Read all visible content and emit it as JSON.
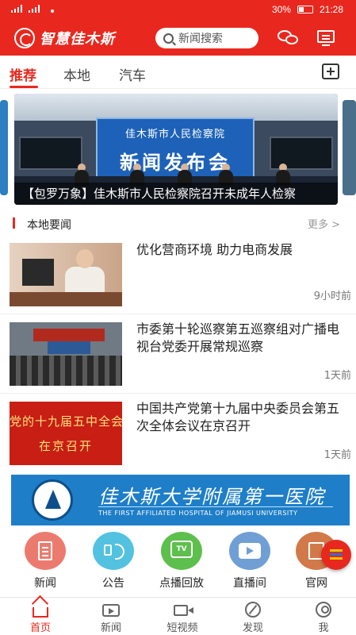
{
  "status_bar": {
    "battery": "30%",
    "time": "21:28"
  },
  "header": {
    "logo_text": "智慧佳木斯",
    "search_placeholder": "新闻搜索"
  },
  "tabs": [
    {
      "label": "推荐",
      "active": true
    },
    {
      "label": "本地",
      "active": false
    },
    {
      "label": "汽车",
      "active": false
    }
  ],
  "carousel": {
    "banner_line1": "佳木斯市人民检察院",
    "banner_line2": "新闻发布会",
    "caption": "【包罗万象】佳木斯市人民检察院召开未成年人检察"
  },
  "section": {
    "title": "本地要闻",
    "more": "更多 >"
  },
  "news": [
    {
      "title": "优化营商环境 助力电商发展",
      "time": "9小时前"
    },
    {
      "title": "市委第十轮巡察第五巡察组对广播电视台党委开展常规巡察",
      "time": "1天前"
    },
    {
      "title": "中国共产党第十九届中央委员会第五次全体会议在京召开",
      "time": "1天前",
      "thumb_line1": "党的十九届五中全会",
      "thumb_line2": "在京召开"
    }
  ],
  "ad": {
    "name_cn": "佳木斯大学附属第一医院",
    "name_en": "THE FIRST AFFILIATED HOSPITAL OF JIAMUSI UNIVERSITY"
  },
  "quick_links": [
    {
      "label": "新闻",
      "color": "#ec7b6f",
      "icon": "document-icon"
    },
    {
      "label": "公告",
      "color": "#52c2e0",
      "icon": "speaker-icon"
    },
    {
      "label": "点播回放",
      "color": "#5dbf4c",
      "icon": "tv-icon",
      "icon_text": "TV"
    },
    {
      "label": "直播间",
      "color": "#6f9fd4",
      "icon": "camera-icon"
    },
    {
      "label": "官网",
      "color": "#d2794a",
      "icon": "web-icon"
    }
  ],
  "bottom_nav": [
    {
      "label": "首页",
      "active": true,
      "icon": "home-icon"
    },
    {
      "label": "新闻",
      "active": false,
      "icon": "tv-icon"
    },
    {
      "label": "短视频",
      "active": false,
      "icon": "video-icon"
    },
    {
      "label": "发现",
      "active": false,
      "icon": "compass-icon"
    },
    {
      "label": "我",
      "active": false,
      "icon": "user-icon"
    }
  ],
  "colors": {
    "brand_red": "#e8281e",
    "text_muted": "#777777"
  }
}
